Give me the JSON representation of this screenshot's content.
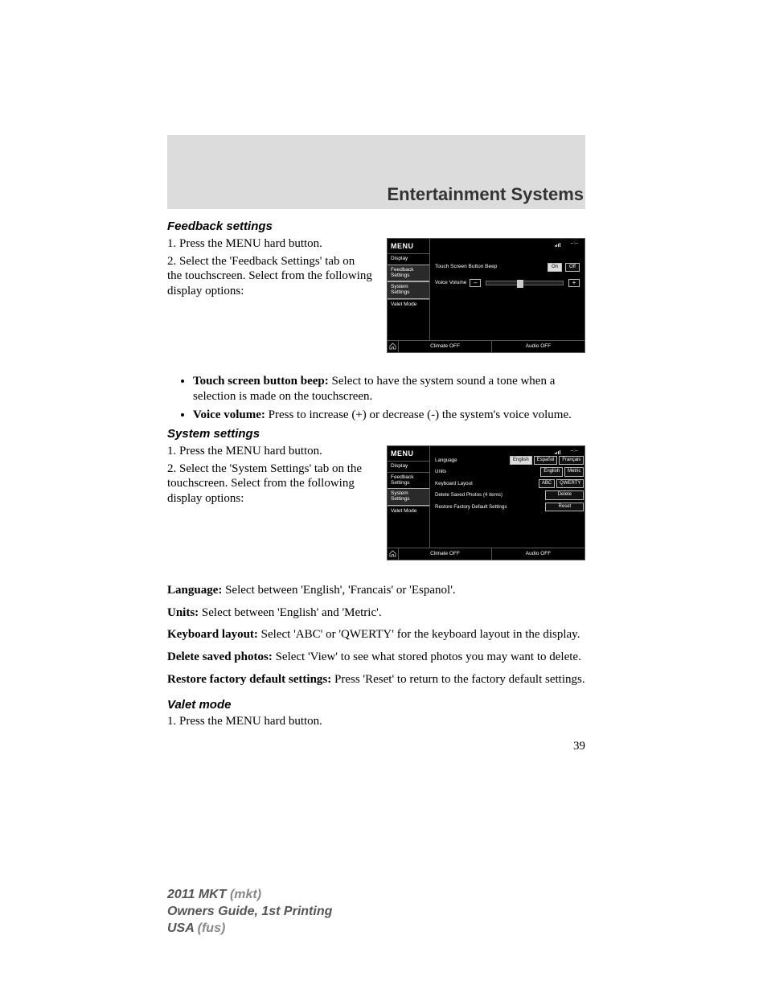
{
  "page_title": "Entertainment Systems",
  "page_number": "39",
  "sections": {
    "feedback": {
      "heading": "Feedback settings",
      "step1": "1. Press the MENU hard button.",
      "step2": "2. Select the 'Feedback Settings' tab on the touchscreen. Select from the following display options:",
      "bullets": {
        "beep_label": "Touch screen button beep:",
        "beep_text": " Select to have the system sound a tone when a selection is made on the touchscreen.",
        "voice_label": "Voice volume:",
        "voice_text": " Press to increase (+) or decrease (-) the system's voice volume."
      }
    },
    "system": {
      "heading": "System settings",
      "step1": "1. Press the MENU hard button.",
      "step2": "2. Select the 'System Settings' tab on the touchscreen. Select from the following display options:",
      "lang_label": "Language:",
      "lang_text": " Select between 'English', 'Francais' or 'Espanol'.",
      "units_label": "Units:",
      "units_text": " Select between 'English' and 'Metric'.",
      "kb_label": "Keyboard layout:",
      "kb_text": " Select 'ABC' or 'QWERTY' for the keyboard layout in the display.",
      "del_label": "Delete saved photos:",
      "del_text": " Select 'View' to see what stored photos you may want to delete.",
      "rst_label": "Restore factory default settings:",
      "rst_text": " Press 'Reset' to return to the factory default settings."
    },
    "valet": {
      "heading": "Valet mode",
      "step1": "1. Press the MENU hard button."
    }
  },
  "shot1": {
    "menu": "MENU",
    "time": "--:--",
    "tabs": {
      "display": "Display",
      "feedback": "Feedback\nSettings",
      "system": "System\nSettings",
      "valet": "Valet Mode"
    },
    "beep_label": "Touch Screen Button Beep",
    "on": "On",
    "off": "Off",
    "voice_label": "Voice Volume",
    "minus": "–",
    "plus": "+",
    "climate": "Climate OFF",
    "audio": "Audio OFF"
  },
  "shot2": {
    "menu": "MENU",
    "time": "--:--",
    "tabs": {
      "display": "Display",
      "feedback": "Feedback\nSettings",
      "system": "System\nSettings",
      "valet": "Valet Mode"
    },
    "rows": {
      "language": {
        "label": "Language",
        "b1": "English",
        "b2": "Español",
        "b3": "Français"
      },
      "units": {
        "label": "Units",
        "b1": "English",
        "b2": "Metric"
      },
      "keyboard": {
        "label": "Keyboard Layout",
        "b1": "ABC",
        "b2": "QWERTY"
      },
      "delete": {
        "label": "Delete Saved Photos (4 items)",
        "b1": "Delete"
      },
      "restore": {
        "label": "Restore Factory Default Settings",
        "b1": "Reset"
      }
    },
    "climate": "Climate OFF",
    "audio": "Audio OFF"
  },
  "footer": {
    "l1a": "2011 MKT ",
    "l1b": "(mkt)",
    "l2": "Owners Guide, 1st Printing",
    "l3a": "USA ",
    "l3b": "(fus)"
  }
}
